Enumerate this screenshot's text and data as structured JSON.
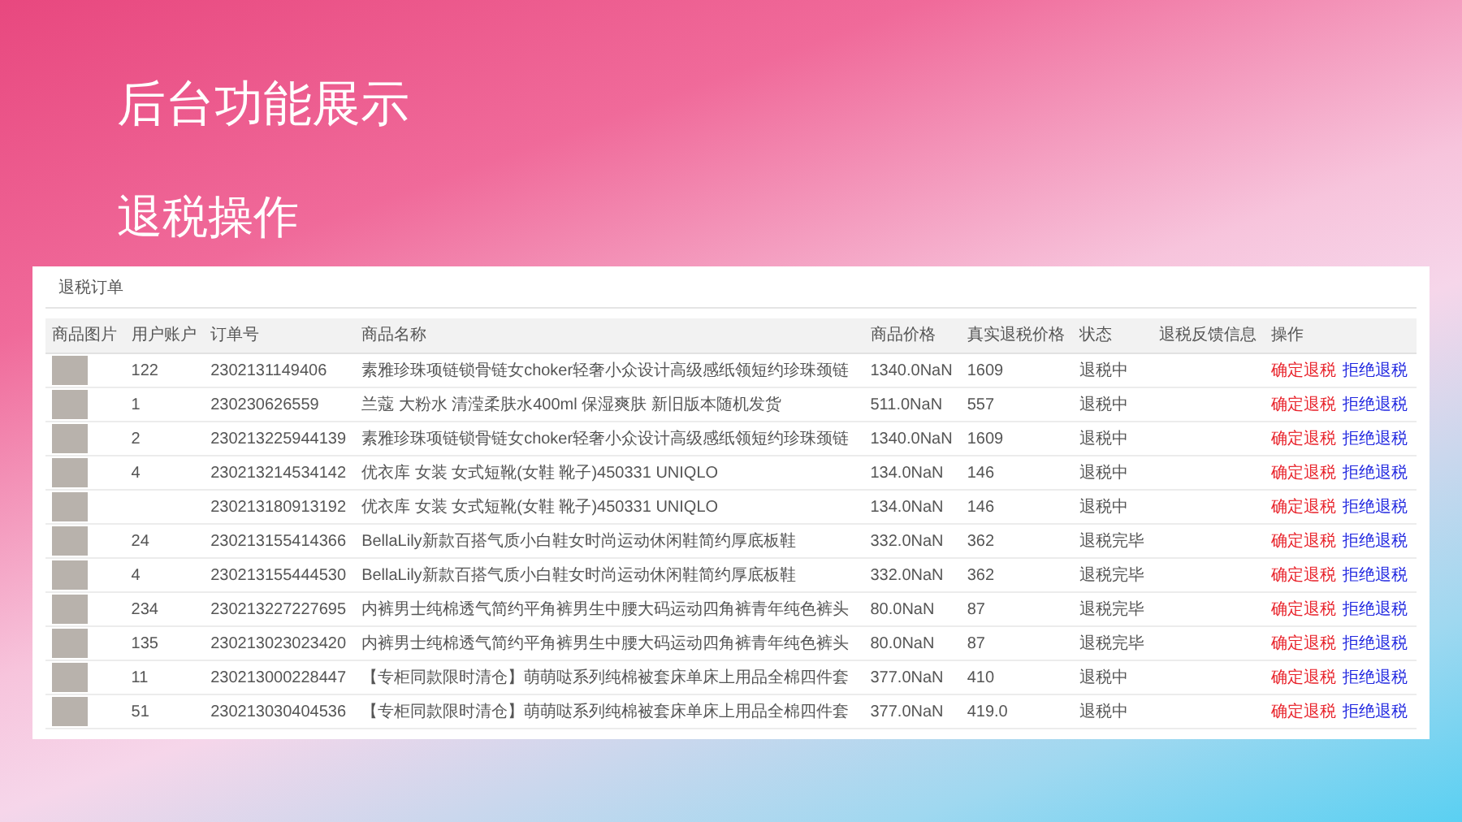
{
  "title": "后台功能展示",
  "subtitle": "退税操作",
  "panel": {
    "legend": "退税订单",
    "columns": [
      "商品图片",
      "用户账户",
      "订单号",
      "商品名称",
      "商品价格",
      "真实退税价格",
      "状态",
      "退税反馈信息",
      "操作"
    ],
    "rows": [
      {
        "account": "122",
        "order": "2302131149406",
        "product": "素雅珍珠项链锁骨链女choker轻奢小众设计高级感纸领短约珍珠颈链",
        "price": "1340.0NaN",
        "refund": "1609",
        "status": "退税中",
        "actions": [
          {
            "kind": "confirm",
            "label": "确定退税"
          },
          {
            "kind": "reject",
            "label": "拒绝退税"
          }
        ]
      },
      {
        "account": "1",
        "order": "230230626559",
        "product": "兰蔻 大粉水 清滢柔肤水400ml 保湿爽肤 新旧版本随机发货",
        "price": "511.0NaN",
        "refund": "557",
        "status": "退税中",
        "actions": [
          {
            "kind": "confirm",
            "label": "确定退税"
          },
          {
            "kind": "reject",
            "label": "拒绝退税"
          }
        ]
      },
      {
        "account": "2",
        "order": "230213225944139",
        "product": "素雅珍珠项链锁骨链女choker轻奢小众设计高级感纸领短约珍珠颈链",
        "price": "1340.0NaN",
        "refund": "1609",
        "status": "退税中",
        "actions": [
          {
            "kind": "confirm",
            "label": "确定退税"
          },
          {
            "kind": "reject",
            "label": "拒绝退税"
          }
        ]
      },
      {
        "account": "4",
        "order": "230213214534142",
        "product": "优衣库 女装 女式短靴(女鞋 靴子)450331 UNIQLO",
        "price": "134.0NaN",
        "refund": "146",
        "status": "退税中",
        "actions": [
          {
            "kind": "confirm",
            "label": "确定退税"
          },
          {
            "kind": "reject",
            "label": "拒绝退税"
          }
        ]
      },
      {
        "account": "",
        "order": "230213180913192",
        "product": "优衣库 女装 女式短靴(女鞋 靴子)450331 UNIQLO",
        "price": "134.0NaN",
        "refund": "146",
        "status": "退税中",
        "actions": [
          {
            "kind": "confirm",
            "label": "确定退税"
          },
          {
            "kind": "reject",
            "label": "拒绝退税"
          }
        ]
      },
      {
        "account": "24",
        "order": "230213155414366",
        "product": "BellaLily新款百搭气质小白鞋女时尚运动休闲鞋简约厚底板鞋",
        "price": "332.0NaN",
        "refund": "362",
        "status": "退税完毕",
        "actions": [
          {
            "kind": "confirm",
            "label": "确定退税"
          },
          {
            "kind": "reject",
            "label": "拒绝退税"
          }
        ]
      },
      {
        "account": "4",
        "order": "230213155444530",
        "product": "BellaLily新款百搭气质小白鞋女时尚运动休闲鞋简约厚底板鞋",
        "price": "332.0NaN",
        "refund": "362",
        "status": "退税完毕",
        "actions": [
          {
            "kind": "confirm",
            "label": "确定退税"
          },
          {
            "kind": "reject",
            "label": "拒绝退税"
          }
        ]
      },
      {
        "account": "234",
        "order": "230213227227695",
        "product": "内裤男士纯棉透气简约平角裤男生中腰大码运动四角裤青年纯色裤头",
        "price": "80.0NaN",
        "refund": "87",
        "status": "退税完毕",
        "actions": [
          {
            "kind": "confirm",
            "label": "确定退税"
          },
          {
            "kind": "reject",
            "label": "拒绝退税"
          }
        ]
      },
      {
        "account": "135",
        "order": "230213023023420",
        "product": "内裤男士纯棉透气简约平角裤男生中腰大码运动四角裤青年纯色裤头",
        "price": "80.0NaN",
        "refund": "87",
        "status": "退税完毕",
        "actions": [
          {
            "kind": "confirm",
            "label": "确定退税"
          },
          {
            "kind": "reject",
            "label": "拒绝退税"
          }
        ]
      },
      {
        "account": "11",
        "order": "230213000228447",
        "product": "【专柜同款限时清仓】萌萌哒系列纯棉被套床单床上用品全棉四件套",
        "price": "377.0NaN",
        "refund": "410",
        "status": "退税中",
        "actions": [
          {
            "kind": "confirm",
            "label": "确定退税"
          },
          {
            "kind": "reject",
            "label": "拒绝退税"
          }
        ]
      },
      {
        "account": "51",
        "order": "230213030404536",
        "product": "【专柜同款限时清仓】萌萌哒系列纯棉被套床单床上用品全棉四件套",
        "price": "377.0NaN",
        "refund": "419.0",
        "status": "退税中",
        "actions": [
          {
            "kind": "confirm",
            "label": "确定退税"
          },
          {
            "kind": "reject",
            "label": "拒绝退税"
          }
        ]
      }
    ]
  }
}
